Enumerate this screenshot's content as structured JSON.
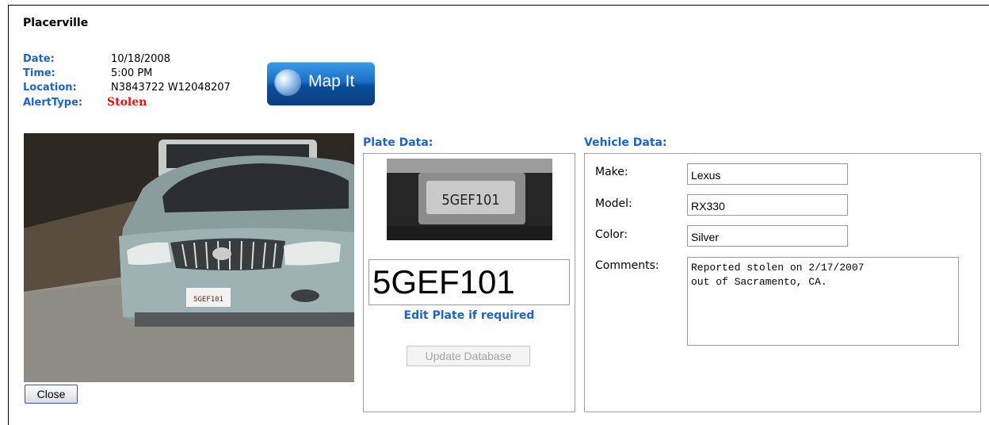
{
  "header": {
    "title": "Placerville"
  },
  "meta": {
    "date_label": "Date:",
    "date_value": "10/18/2008",
    "time_label": "Time:",
    "time_value": "5:00 PM",
    "location_label": "Location:",
    "location_value": "N3843722 W12048207",
    "alert_label": "AlertType:",
    "alert_value": "Stolen"
  },
  "map_button": {
    "label": "Map It",
    "icon": "globe-icon"
  },
  "photo": {
    "plate_overlay": "5GEF101"
  },
  "buttons": {
    "close": "Close",
    "update": "Update Database"
  },
  "plate": {
    "section_title": "Plate Data:",
    "image_text": "5GEF101",
    "value": "5GEF101",
    "edit_note": "Edit Plate if required"
  },
  "vehicle": {
    "section_title": "Vehicle Data:",
    "make_label": "Make:",
    "make_value": "Lexus",
    "model_label": "Model:",
    "model_value": "RX330",
    "color_label": "Color:",
    "color_value": "Silver",
    "comments_label": "Comments:",
    "comments_value": "Reported stolen on 2/17/2007\nout of Sacramento, CA."
  },
  "colors": {
    "accent": "#1f63c4",
    "alert": "#e3140f"
  }
}
